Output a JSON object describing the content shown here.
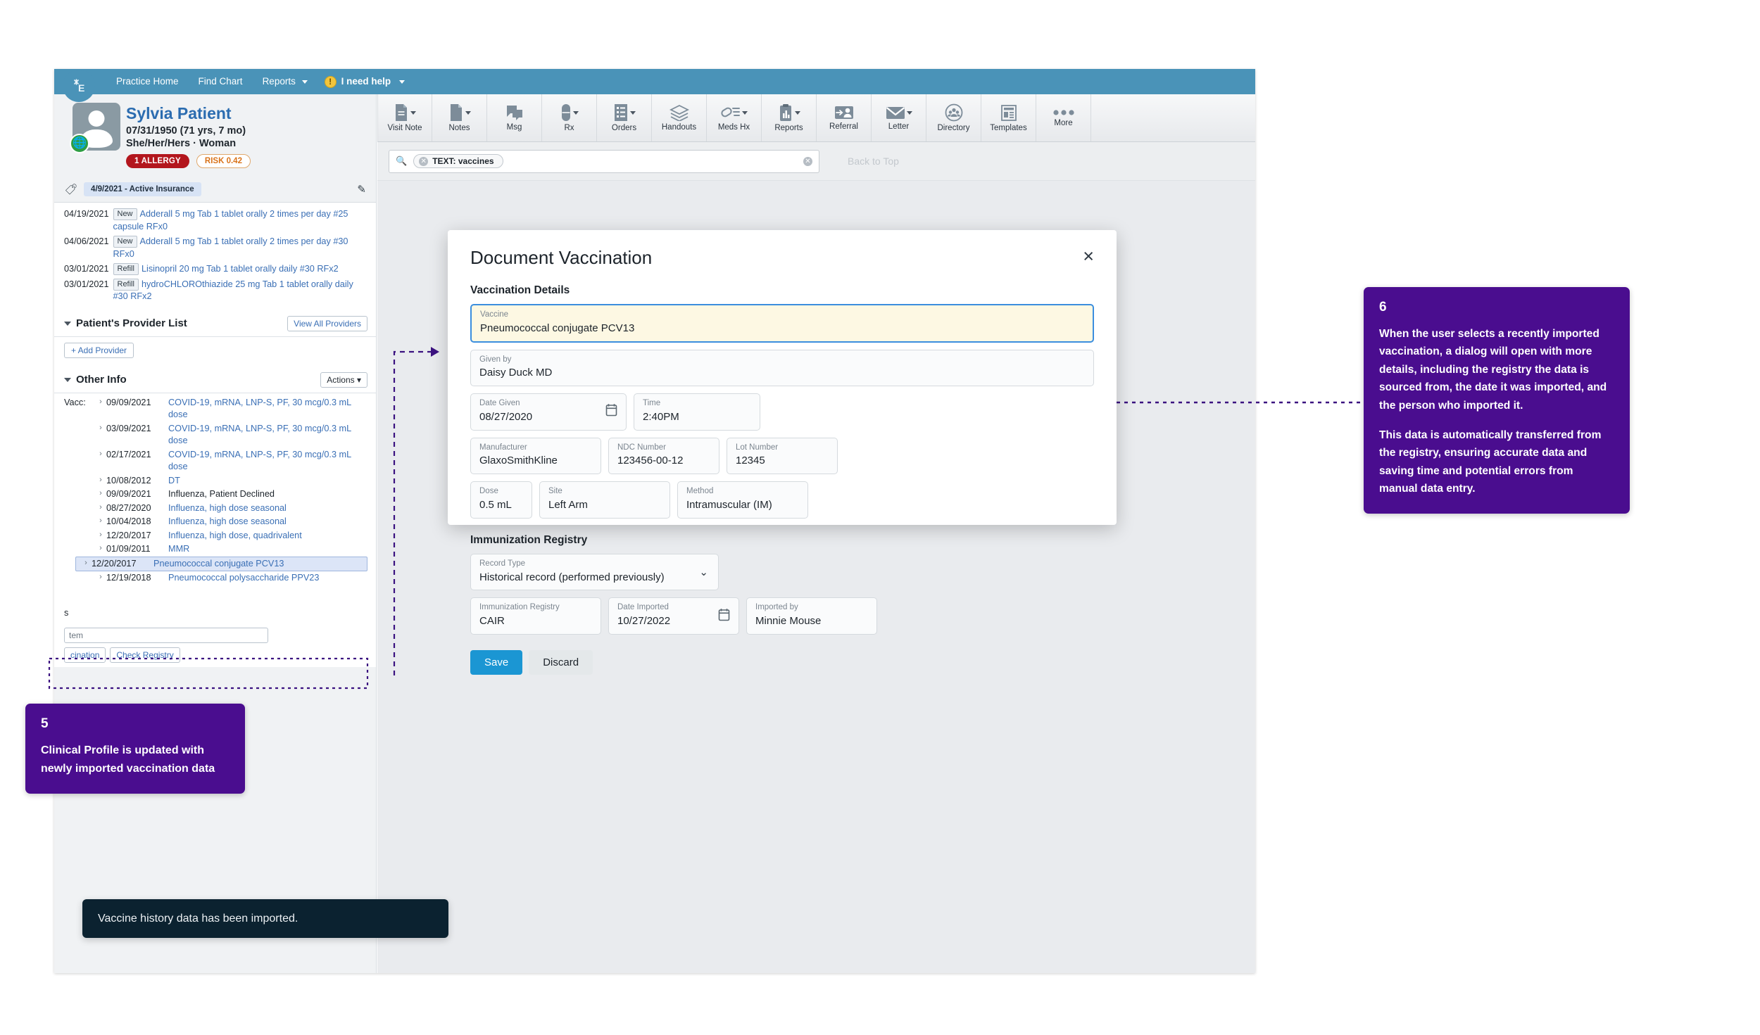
{
  "topnav": {
    "logo": "E",
    "items": [
      {
        "label": "Practice Home",
        "caret": false
      },
      {
        "label": "Find Chart",
        "caret": false
      },
      {
        "label": "Reports",
        "caret": true
      }
    ],
    "help_label": "I need help",
    "help_icon": "!"
  },
  "patient": {
    "name": "Sylvia Patient",
    "dob_line": "07/31/1950 (71 yrs, 7 mo)",
    "pronouns_line": "She/Her/Hers · Woman",
    "allergy_badge": "1 ALLERGY",
    "risk_badge": "RISK 0.42",
    "insurance_pill": "4/9/2021 - Active Insurance"
  },
  "medications": [
    {
      "date": "04/19/2021",
      "tag": "New",
      "text": "Adderall 5 mg Tab 1 tablet orally 2 times per day #25 capsule RFx0"
    },
    {
      "date": "04/06/2021",
      "tag": "New",
      "text": "Adderall 5 mg Tab 1 tablet orally 2 times per day #30 RFx0"
    },
    {
      "date": "03/01/2021",
      "tag": "Refill",
      "text": "Lisinopril 20 mg Tab 1 tablet orally daily #30 RFx2"
    },
    {
      "date": "03/01/2021",
      "tag": "Refill",
      "text": "hydroCHLOROthiazide 25 mg Tab 1 tablet orally daily #30 RFx2"
    }
  ],
  "provider_section": {
    "title": "Patient's Provider List",
    "view_all_label": "View All Providers",
    "add_provider_label": "+ Add Provider"
  },
  "other_info": {
    "title": "Other Info",
    "actions_label": "Actions",
    "vacc_label": "Vacc:",
    "rows": [
      {
        "date": "09/09/2021",
        "name": "COVID-19, mRNA, LNP-S, PF, 30 mcg/0.3 mL dose",
        "link": true,
        "highlight": false
      },
      {
        "date": "03/09/2021",
        "name": "COVID-19, mRNA, LNP-S, PF, 30 mcg/0.3 mL dose",
        "link": true,
        "highlight": false
      },
      {
        "date": "02/17/2021",
        "name": "COVID-19, mRNA, LNP-S, PF, 30 mcg/0.3 mL dose",
        "link": true,
        "highlight": false
      },
      {
        "date": "10/08/2012",
        "name": "DT",
        "link": true,
        "highlight": false
      },
      {
        "date": "09/09/2021",
        "name": "Influenza, Patient Declined",
        "link": false,
        "highlight": false
      },
      {
        "date": "08/27/2020",
        "name": "Influenza, high dose seasonal",
        "link": true,
        "highlight": false
      },
      {
        "date": "10/04/2018",
        "name": "Influenza, high dose seasonal",
        "link": true,
        "highlight": false
      },
      {
        "date": "12/20/2017",
        "name": "Influenza, high dose, quadrivalent",
        "link": true,
        "highlight": false
      },
      {
        "date": "01/09/2011",
        "name": "MMR",
        "link": true,
        "highlight": false
      },
      {
        "date": "12/20/2017",
        "name": "Pneumococcal conjugate PCV13",
        "link": true,
        "highlight": true
      },
      {
        "date": "12/19/2018",
        "name": "Pneumococcal polysaccharide PPV23",
        "link": true,
        "highlight": false
      }
    ]
  },
  "sidebar_partial": {
    "fragment_text": "s",
    "input_placeholder_fragment": "tem",
    "btn_vaccination": "cination",
    "btn_check_registry": "Check Registry"
  },
  "toolbar": [
    {
      "label": "Visit Note",
      "icon": "visit-note-icon",
      "caret": true
    },
    {
      "label": "Notes",
      "icon": "notes-icon",
      "caret": true
    },
    {
      "label": "Msg",
      "icon": "message-icon",
      "caret": false
    },
    {
      "label": "Rx",
      "icon": "pill-icon",
      "caret": true
    },
    {
      "label": "Orders",
      "icon": "orders-list-icon",
      "caret": true
    },
    {
      "label": "Handouts",
      "icon": "handouts-stack-icon",
      "caret": false
    },
    {
      "label": "Meds Hx",
      "icon": "meds-history-icon",
      "caret": true
    },
    {
      "label": "Reports",
      "icon": "reports-clipboard-icon",
      "caret": true
    },
    {
      "label": "Referral",
      "icon": "referral-person-icon",
      "caret": false
    },
    {
      "label": "Letter",
      "icon": "envelope-icon",
      "caret": true
    },
    {
      "label": "Directory",
      "icon": "directory-group-icon",
      "caret": false
    },
    {
      "label": "Templates",
      "icon": "templates-layout-icon",
      "caret": false
    },
    {
      "label": "More",
      "icon": "more-dots-icon",
      "caret": false
    }
  ],
  "search": {
    "chip_label": "TEXT: vaccines",
    "back_to_top": "Back to Top"
  },
  "modal": {
    "title": "Document Vaccination",
    "close_icon": "×",
    "section_details": "Vaccination Details",
    "section_registry": "Immunization Registry",
    "fields": {
      "vaccine": {
        "label": "Vaccine",
        "value": "Pneumococcal conjugate PCV13"
      },
      "given_by": {
        "label": "Given by",
        "value": "Daisy Duck MD"
      },
      "date_given": {
        "label": "Date Given",
        "value": "08/27/2020"
      },
      "time": {
        "label": "Time",
        "value": "2:40PM"
      },
      "manufacturer": {
        "label": "Manufacturer",
        "value": "GlaxoSmithKline"
      },
      "ndc_number": {
        "label": "NDC Number",
        "value": "123456-00-12"
      },
      "lot_number": {
        "label": "Lot Number",
        "value": "12345"
      },
      "dose": {
        "label": "Dose",
        "value": "0.5 mL"
      },
      "site": {
        "label": "Site",
        "value": "Left Arm"
      },
      "method": {
        "label": "Method",
        "value": "Intramuscular (IM)"
      },
      "record_type": {
        "label": "Record Type",
        "value": "Historical record (performed previously)"
      },
      "immunization_registry": {
        "label": "Immunization Registry",
        "value": "CAIR"
      },
      "date_imported": {
        "label": "Date Imported",
        "value": "10/27/2022"
      },
      "imported_by": {
        "label": "Imported by",
        "value": "Minnie Mouse"
      }
    },
    "save_label": "Save",
    "discard_label": "Discard"
  },
  "callouts": {
    "five": {
      "number": "5",
      "text": "Clinical Profile is updated with newly imported vaccination data"
    },
    "six": {
      "number": "6",
      "para1": "When the user selects a recently imported vaccination, a dialog will open with more details, including the registry the data is sourced from, the date it was imported, and the person who imported it.",
      "para2": "This data is automatically transferred from the registry, ensuring accurate data and saving time and potential errors from manual data entry."
    }
  },
  "toast": {
    "message": "Vaccine history data has been imported."
  },
  "colors": {
    "topbar": "#4a93b8",
    "callout_purple": "#4a0d8f",
    "primary_button": "#1b96d3",
    "allergy_red": "#b3161d",
    "risk_orange": "#d9731a",
    "link_blue": "#3a6fb5",
    "focus_blue": "#3b8ede",
    "focus_field_bg": "#fdf8e3",
    "toast_dark": "#0b2230"
  }
}
